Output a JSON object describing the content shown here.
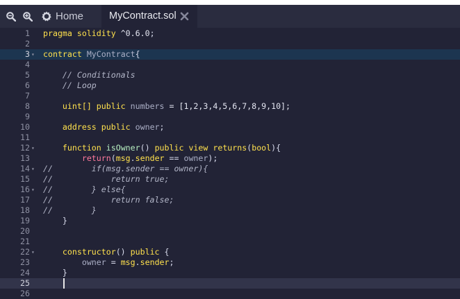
{
  "tabs": {
    "home_label": "Home",
    "active_label": "MyContract.sol"
  },
  "icons": {
    "zoom_out": "zoom-out-icon",
    "zoom_in": "zoom-in-icon",
    "home": "home-icon",
    "close": "close-icon"
  },
  "editor": {
    "highlighted_line": 3,
    "current_line": 25,
    "lines": [
      {
        "n": "1",
        "fold": "",
        "tokens": [
          {
            "t": "pragma solidity ",
            "c": "kw"
          },
          {
            "t": "^0.6.0",
            "c": "num"
          },
          {
            "t": ";",
            "c": "ty"
          }
        ]
      },
      {
        "n": "2",
        "fold": "",
        "tokens": []
      },
      {
        "n": "3",
        "fold": "▾",
        "tokens": [
          {
            "t": "contract ",
            "c": "kw"
          },
          {
            "t": "MyContract",
            "c": "var"
          },
          {
            "t": "{",
            "c": "ty"
          }
        ]
      },
      {
        "n": "4",
        "fold": "",
        "tokens": []
      },
      {
        "n": "5",
        "fold": "",
        "tokens": [
          {
            "t": "    // Conditionals",
            "c": "cm"
          }
        ]
      },
      {
        "n": "6",
        "fold": "",
        "tokens": [
          {
            "t": "    // Loop",
            "c": "cm"
          }
        ]
      },
      {
        "n": "7",
        "fold": "",
        "tokens": []
      },
      {
        "n": "8",
        "fold": "",
        "tokens": [
          {
            "t": "    uint[] ",
            "c": "kw"
          },
          {
            "t": "public ",
            "c": "kw"
          },
          {
            "t": "numbers",
            "c": "var"
          },
          {
            "t": " = [1,2,3,4,5,6,7,8,9,10];",
            "c": "num"
          }
        ]
      },
      {
        "n": "9",
        "fold": "",
        "tokens": []
      },
      {
        "n": "10",
        "fold": "",
        "tokens": [
          {
            "t": "    address ",
            "c": "kw"
          },
          {
            "t": "public ",
            "c": "kw"
          },
          {
            "t": "owner",
            "c": "var"
          },
          {
            "t": ";",
            "c": "ty"
          }
        ]
      },
      {
        "n": "11",
        "fold": "",
        "tokens": []
      },
      {
        "n": "12",
        "fold": "▾",
        "tokens": [
          {
            "t": "    function ",
            "c": "kw"
          },
          {
            "t": "isOwner",
            "c": "fn"
          },
          {
            "t": "() ",
            "c": "ty"
          },
          {
            "t": "public ",
            "c": "kw"
          },
          {
            "t": "view ",
            "c": "kw"
          },
          {
            "t": "returns",
            "c": "kw"
          },
          {
            "t": "(",
            "c": "ty"
          },
          {
            "t": "bool",
            "c": "kw"
          },
          {
            "t": "){",
            "c": "ty"
          }
        ]
      },
      {
        "n": "13",
        "fold": "",
        "tokens": [
          {
            "t": "        return",
            "c": "ret"
          },
          {
            "t": "(",
            "c": "ty"
          },
          {
            "t": "msg",
            "c": "kw"
          },
          {
            "t": ".",
            "c": "ty"
          },
          {
            "t": "sender",
            "c": "kw"
          },
          {
            "t": " == ",
            "c": "ty"
          },
          {
            "t": "owner",
            "c": "var"
          },
          {
            "t": ");",
            "c": "ty"
          }
        ]
      },
      {
        "n": "14",
        "fold": "▾",
        "tokens": [
          {
            "t": "//        if(msg.sender == owner){",
            "c": "cm"
          }
        ]
      },
      {
        "n": "15",
        "fold": "",
        "tokens": [
          {
            "t": "//            return true;",
            "c": "cm"
          }
        ]
      },
      {
        "n": "16",
        "fold": "▾",
        "tokens": [
          {
            "t": "//        } else{",
            "c": "cm"
          }
        ]
      },
      {
        "n": "17",
        "fold": "",
        "tokens": [
          {
            "t": "//            return false;",
            "c": "cm"
          }
        ]
      },
      {
        "n": "18",
        "fold": "",
        "tokens": [
          {
            "t": "//        }",
            "c": "cm"
          }
        ]
      },
      {
        "n": "19",
        "fold": "",
        "tokens": [
          {
            "t": "    }",
            "c": "ty"
          }
        ]
      },
      {
        "n": "20",
        "fold": "",
        "tokens": []
      },
      {
        "n": "21",
        "fold": "",
        "tokens": []
      },
      {
        "n": "22",
        "fold": "▾",
        "tokens": [
          {
            "t": "    constructor",
            "c": "kw"
          },
          {
            "t": "() ",
            "c": "ty"
          },
          {
            "t": "public",
            "c": "kw"
          },
          {
            "t": " {",
            "c": "ty"
          }
        ]
      },
      {
        "n": "23",
        "fold": "",
        "tokens": [
          {
            "t": "        owner",
            "c": "var"
          },
          {
            "t": " = ",
            "c": "ty"
          },
          {
            "t": "msg",
            "c": "kw"
          },
          {
            "t": ".",
            "c": "ty"
          },
          {
            "t": "sender",
            "c": "kw"
          },
          {
            "t": ";",
            "c": "ty"
          }
        ]
      },
      {
        "n": "24",
        "fold": "",
        "tokens": [
          {
            "t": "    }",
            "c": "ty"
          }
        ]
      },
      {
        "n": "25",
        "fold": "",
        "tokens": []
      },
      {
        "n": "26",
        "fold": "",
        "tokens": []
      }
    ]
  }
}
